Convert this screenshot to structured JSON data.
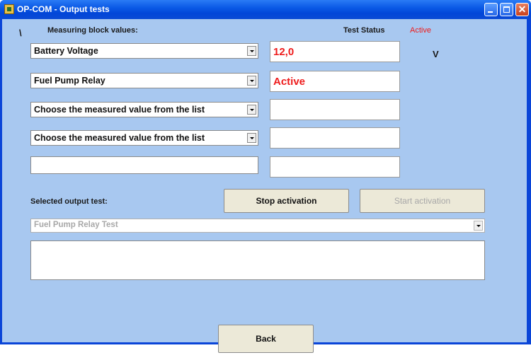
{
  "window": {
    "title": "OP-COM - Output tests"
  },
  "labels": {
    "stray_mark": "\\",
    "measuring_block": "Measuring block values:",
    "test_status": "Test Status",
    "test_status_value": "Active",
    "unit_row1": "V",
    "selected_output_test": "Selected output test:"
  },
  "measurements": [
    {
      "selector": "Battery Voltage",
      "value": "12,0"
    },
    {
      "selector": "Fuel Pump Relay",
      "value": "Active"
    },
    {
      "selector": "Choose the measured value from the list",
      "value": ""
    },
    {
      "selector": "Choose the measured value from the list",
      "value": ""
    },
    {
      "selector": "",
      "value": ""
    }
  ],
  "buttons": {
    "stop_activation": "Stop activation",
    "start_activation": "Start activation",
    "back": "Back"
  },
  "output_test": {
    "selected": "Fuel Pump Relay Test"
  },
  "notes_box": {
    "value": ""
  },
  "colors": {
    "accent_red": "#ee1c1c",
    "client_bg": "#a8c8f0",
    "titlebar": "#0b5ae6"
  }
}
